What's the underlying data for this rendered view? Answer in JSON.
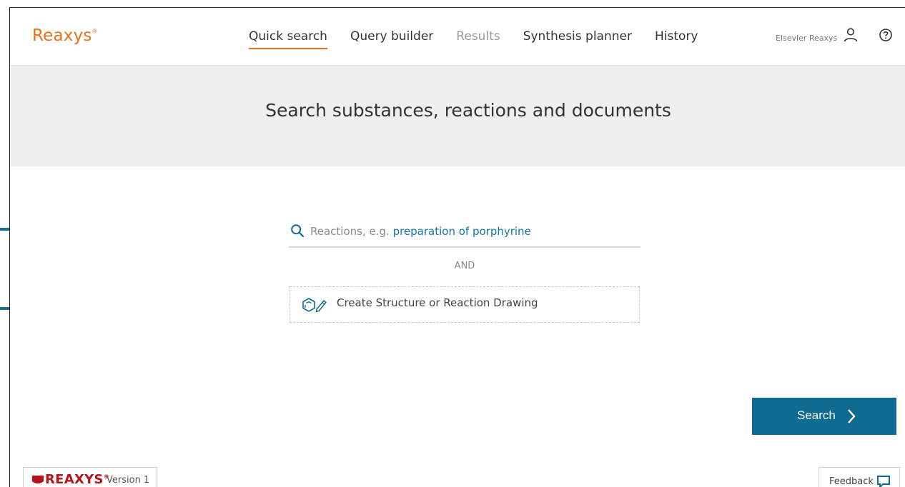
{
  "app": {
    "logo": "Reaxys",
    "logo_mark": "®"
  },
  "nav": {
    "items": [
      {
        "label": "Quick search",
        "state": "active"
      },
      {
        "label": "Query builder",
        "state": "normal"
      },
      {
        "label": "Results",
        "state": "disabled"
      },
      {
        "label": "Synthesis planner",
        "state": "normal"
      },
      {
        "label": "History",
        "state": "normal"
      }
    ]
  },
  "account": {
    "name": "Elsevier Reaxys",
    "user_icon": "user-icon",
    "help_icon": "help-icon"
  },
  "banner": {
    "title": "Search substances, reactions and documents"
  },
  "search": {
    "placeholder_prefix": "Reactions, e.g. ",
    "placeholder_example": "preparation of porphyrine",
    "icon": "search-icon"
  },
  "connector": {
    "label": "AND"
  },
  "drawing": {
    "label": "Create Structure or Reaction Drawing",
    "icon": "structure-editor-icon"
  },
  "actions": {
    "search_label": "Search"
  },
  "footer": {
    "brand": "REAXYS",
    "brand_mark": "®",
    "version": "Version 1",
    "feedback_label": "Feedback"
  },
  "colors": {
    "accent": "#e9711c",
    "primary": "#0f6c90",
    "link": "#0f77a8",
    "brand_red": "#b8141c",
    "banner_bg": "#efefef"
  }
}
